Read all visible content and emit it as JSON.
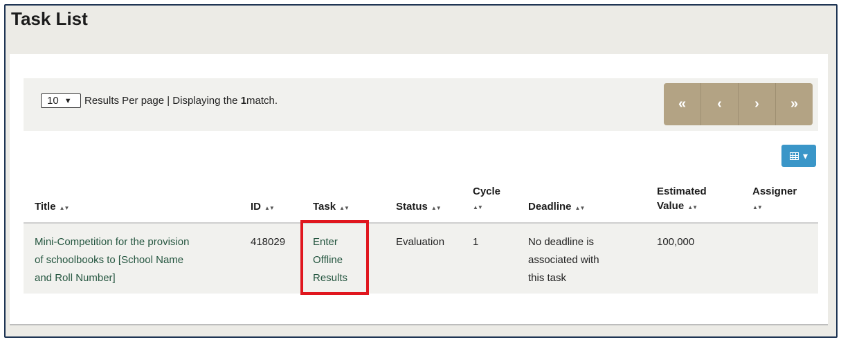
{
  "page": {
    "title": "Task List"
  },
  "pagination": {
    "per_page_value": "10",
    "per_page_text": "Results Per page | Displaying the ",
    "match_count": "1",
    "match_suffix": " match.",
    "buttons": {
      "first": "«",
      "prev": "‹",
      "next": "›",
      "last": "»"
    }
  },
  "column_toggle": {
    "icon": "grid-icon",
    "caret": "▾"
  },
  "table": {
    "headers": {
      "title": "Title",
      "id": "ID",
      "task": "Task",
      "status": "Status",
      "cycle": "Cycle",
      "deadline": "Deadline",
      "estimated_value_1": "Estimated",
      "estimated_value_2": "Value",
      "assigner": "Assigner"
    },
    "sort_glyph": "▲▼",
    "rows": [
      {
        "title_lines": [
          "Mini-Competition for the provision",
          "of schoolbooks to [School Name",
          "and Roll Number]"
        ],
        "id": "418029",
        "task_lines": [
          "Enter",
          "Offline",
          "Results"
        ],
        "status": "Evaluation",
        "cycle": "1",
        "deadline_lines": [
          "No deadline is",
          "associated with",
          "this task"
        ],
        "estimated_value": "100,000",
        "assigner": ""
      }
    ]
  },
  "colors": {
    "accent_tan": "#b3a384",
    "accent_blue": "#3a96c8",
    "highlight": "#e0161e",
    "link": "#24553f"
  }
}
